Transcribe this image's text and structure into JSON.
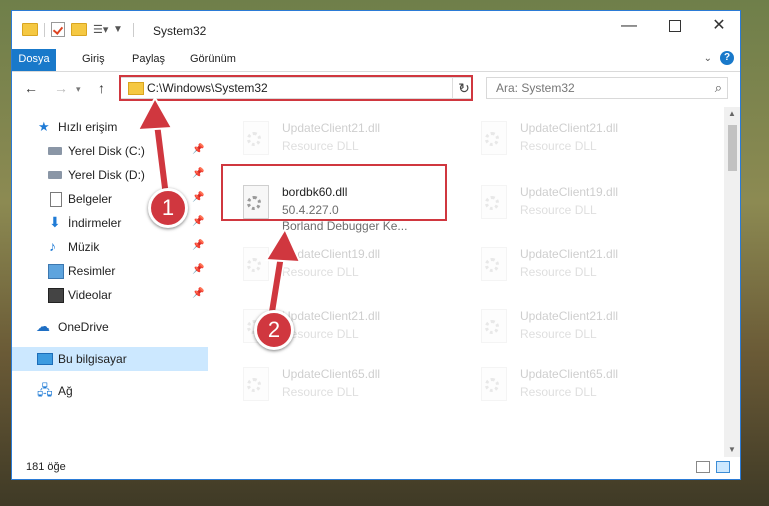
{
  "window": {
    "title": "System32",
    "controls": {
      "minimize": "—",
      "close": "✕"
    }
  },
  "ribbon": {
    "tabs": [
      {
        "label": "Dosya"
      },
      {
        "label": "Giriş"
      },
      {
        "label": "Paylaş"
      },
      {
        "label": "Görünüm"
      }
    ],
    "help": "?"
  },
  "address": {
    "path": "C:\\Windows\\System32",
    "search_placeholder": "Ara: System32"
  },
  "nav": {
    "items": [
      {
        "label": "Hızlı erişim",
        "icon": "star-icon"
      },
      {
        "label": "Yerel Disk (C:)",
        "icon": "disk-icon",
        "pinned": true
      },
      {
        "label": "Yerel Disk (D:)",
        "icon": "disk-icon",
        "pinned": true
      },
      {
        "label": "Belgeler",
        "icon": "document-icon",
        "pinned": true
      },
      {
        "label": "İndirmeler",
        "icon": "download-icon",
        "pinned": true
      },
      {
        "label": "Müzik",
        "icon": "music-icon",
        "pinned": true
      },
      {
        "label": "Resimler",
        "icon": "picture-icon",
        "pinned": true
      },
      {
        "label": "Videolar",
        "icon": "video-icon",
        "pinned": true
      },
      {
        "label": "OneDrive",
        "icon": "cloud-icon"
      },
      {
        "label": "Bu bilgisayar",
        "icon": "computer-icon",
        "selected": true
      },
      {
        "label": "Ağ",
        "icon": "network-icon"
      }
    ]
  },
  "files": {
    "left": [
      {
        "name": "UpdateClient21.dll",
        "desc": "Resource DLL"
      },
      {
        "name": "bordbk60.dll",
        "version": "50.4.227.0",
        "desc": "Borland Debugger Ke..."
      },
      {
        "name": "UpdateClient19.dll",
        "desc": "Resource DLL"
      },
      {
        "name": "UpdateClient21.dll",
        "desc": "Resource DLL"
      },
      {
        "name": "UpdateClient65.dll",
        "desc": "Resource DLL"
      }
    ],
    "right": [
      {
        "name": "UpdateClient21.dll",
        "desc": "Resource DLL"
      },
      {
        "name": "UpdateClient19.dll",
        "desc": "Resource DLL"
      },
      {
        "name": "UpdateClient21.dll",
        "desc": "Resource DLL"
      },
      {
        "name": "UpdateClient21.dll",
        "desc": "Resource DLL"
      },
      {
        "name": "UpdateClient65.dll",
        "desc": "Resource DLL"
      }
    ]
  },
  "status": {
    "count": "181 öğe"
  },
  "annotations": {
    "step1": "1",
    "step2": "2",
    "accent": "#d0373f"
  }
}
